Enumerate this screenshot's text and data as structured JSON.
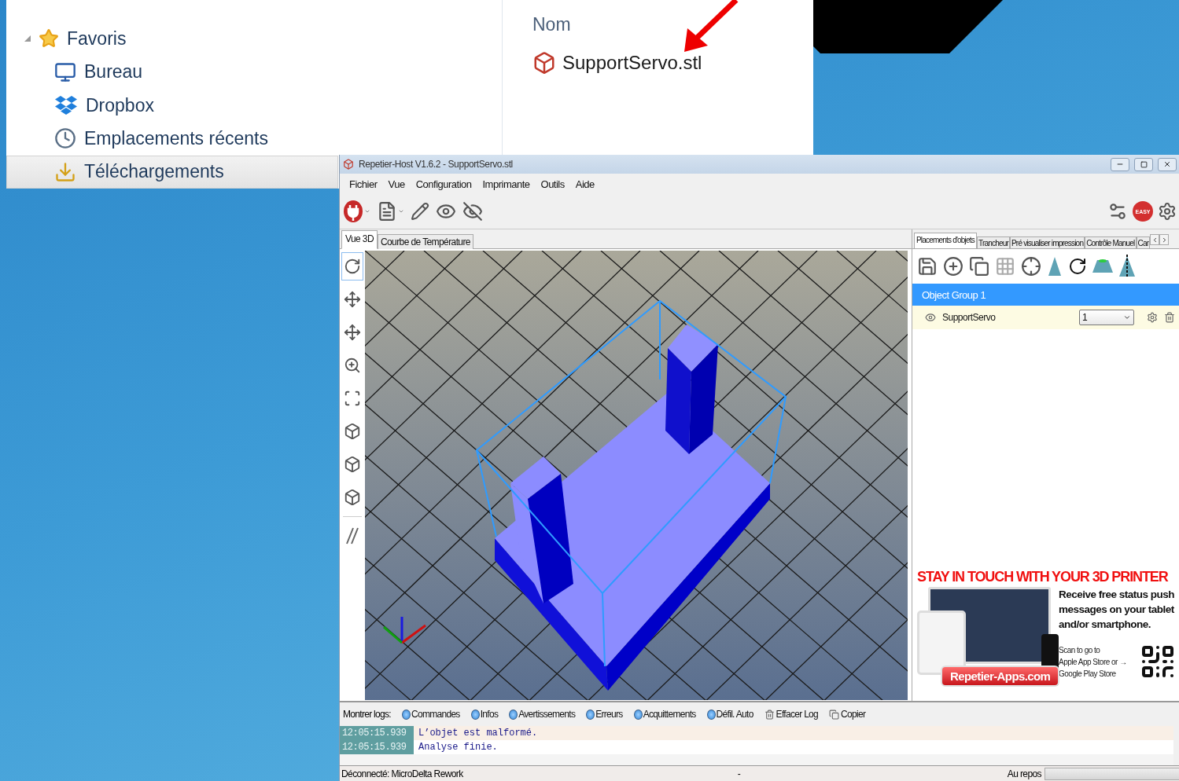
{
  "explorer": {
    "sidebar": {
      "items": [
        {
          "label": "Favoris",
          "selected": false,
          "expanded": true
        },
        {
          "label": "Bureau",
          "selected": false
        },
        {
          "label": "Dropbox",
          "selected": false
        },
        {
          "label": "Emplacements récents",
          "selected": false
        },
        {
          "label": "Téléchargements",
          "selected": true
        }
      ]
    },
    "columns": [
      "Nom"
    ],
    "files": [
      {
        "name": "SupportServo.stl"
      }
    ]
  },
  "app": {
    "window": {
      "title": "Repetier-Host V1.6.2 - SupportServo.stl"
    },
    "menu": [
      "Fichier",
      "Vue",
      "Configuration",
      "Imprimante",
      "Outils",
      "Aide"
    ],
    "easy_button": "EASY",
    "view_tabs": [
      {
        "label": "Vue 3D",
        "selected": true
      },
      {
        "label": "Courbe de Température",
        "selected": false
      }
    ],
    "right_tabs": [
      {
        "label": "Placements d'objets",
        "selected": true
      },
      {
        "label": "Trancheur",
        "selected": false
      },
      {
        "label": "Pré visualiser impression",
        "selected": false
      },
      {
        "label": "Contrôle Manuel",
        "selected": false
      },
      {
        "label": "Car",
        "selected": false
      }
    ],
    "object_group": {
      "title": "Object Group 1",
      "objects": [
        {
          "name": "SupportServo",
          "copies": "1",
          "visible": true
        }
      ]
    },
    "ad": {
      "headline": "STAY IN TOUCH WITH YOUR 3D PRINTER",
      "body": "Receive free status push messages on your tablet and/or smartphone.",
      "scan": "Scan to go to\nApple App Store or →\nGoogle Play Store",
      "link": "Repetier-Apps.com"
    },
    "log": {
      "label": "Montrer logs:",
      "filters": [
        {
          "label": "Commandes",
          "on": true
        },
        {
          "label": "Infos",
          "on": true
        },
        {
          "label": "Avertissements",
          "on": true
        },
        {
          "label": "Erreurs",
          "on": true
        },
        {
          "label": "Acquittements",
          "on": true
        },
        {
          "label": "Défil. Auto",
          "on": true
        }
      ],
      "actions": [
        "Effacer Log",
        "Copier"
      ],
      "entries": [
        {
          "time": "12:05:15.939",
          "text": "L’objet est malformé.",
          "kind": "warning"
        },
        {
          "time": "12:05:15.939",
          "text": "Analyse finie.",
          "kind": "info"
        }
      ]
    },
    "status_bar": {
      "connection": "Déconnecté: MicroDelta Rework",
      "middle": "-",
      "state": "Au repos",
      "progress": {
        "level": 0
      }
    }
  }
}
